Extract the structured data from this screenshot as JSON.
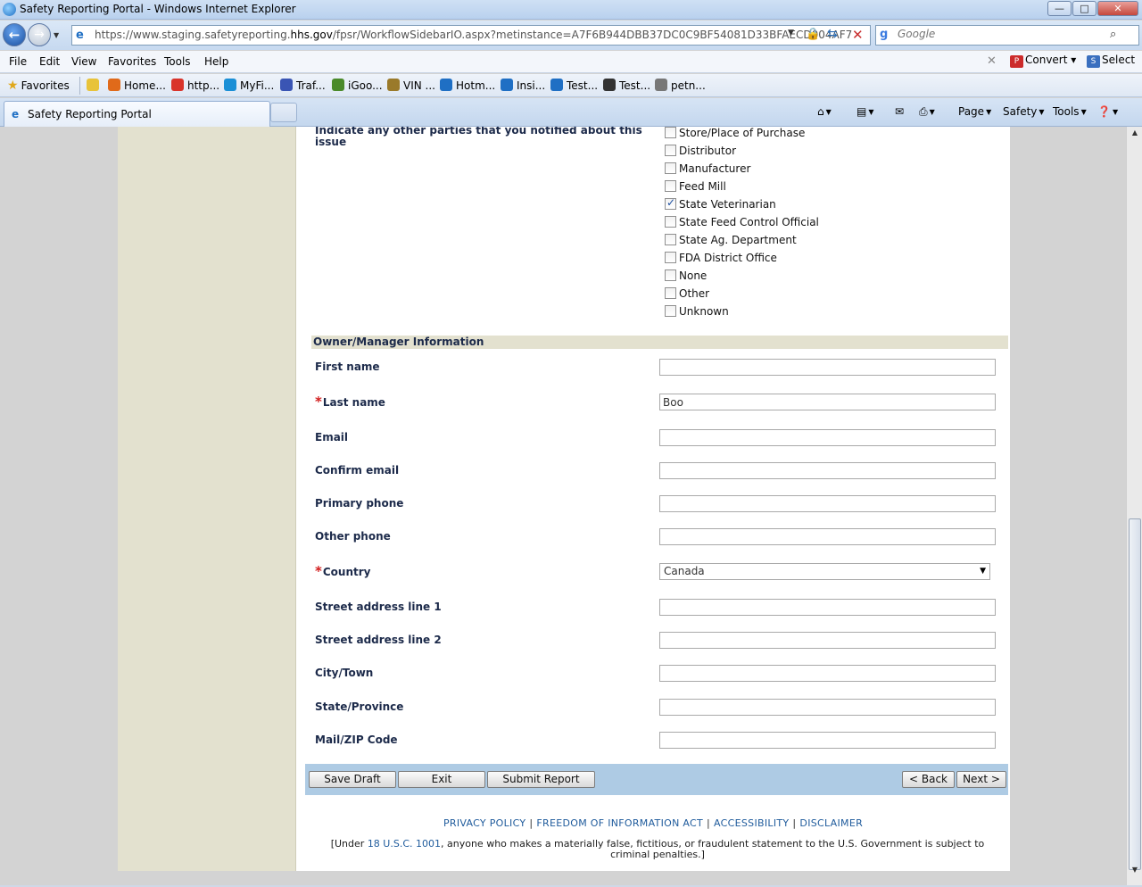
{
  "window": {
    "title": "Safety Reporting Portal - Windows Internet Explorer",
    "min": "—",
    "max": "□",
    "close": "✕"
  },
  "address": {
    "url_prefix": "https://www.staging.safetyreporting.",
    "url_host": "hhs.gov",
    "url_suffix": "/fpsr/WorkflowSidebarIO.aspx?metinstance=A7F6B944DBB37DC0C9BF54081D33BFAECD004AF7"
  },
  "search": {
    "placeholder": "Google"
  },
  "menu": {
    "items": [
      "File",
      "Edit",
      "View",
      "Favorites",
      "Tools",
      "Help"
    ],
    "convert": "Convert",
    "select": "Select"
  },
  "favorites": {
    "label": "Favorites",
    "links": [
      {
        "label": "Home...",
        "color": "#e06a1a"
      },
      {
        "label": "http...",
        "color": "#d9342b"
      },
      {
        "label": "MyFi...",
        "color": "#1a8fd6"
      },
      {
        "label": "Traf...",
        "color": "#3a55b4"
      },
      {
        "label": "iGoo...",
        "color": "#4a8a2a"
      },
      {
        "label": "VIN ...",
        "color": "#9a7a2a"
      },
      {
        "label": "Hotm...",
        "color": "#1f6fc4"
      },
      {
        "label": "Insi...",
        "color": "#1f6fc4"
      },
      {
        "label": "Test...",
        "color": "#1f6fc4"
      },
      {
        "label": "Test...",
        "color": "#333333"
      },
      {
        "label": "petn...",
        "color": "#555555"
      }
    ]
  },
  "tab": {
    "label": "Safety Reporting Portal"
  },
  "commands": {
    "page": "Page",
    "safety": "Safety",
    "tools": "Tools"
  },
  "form": {
    "notify_question": "Indicate any other parties that you notified about this issue",
    "parties": [
      {
        "label": "Store/Place of Purchase",
        "checked": false
      },
      {
        "label": "Distributor",
        "checked": false
      },
      {
        "label": "Manufacturer",
        "checked": false
      },
      {
        "label": "Feed Mill",
        "checked": false
      },
      {
        "label": "State Veterinarian",
        "checked": true
      },
      {
        "label": "State Feed Control Official",
        "checked": false
      },
      {
        "label": "State Ag. Department",
        "checked": false
      },
      {
        "label": "FDA District Office",
        "checked": false
      },
      {
        "label": "None",
        "checked": false
      },
      {
        "label": "Other",
        "checked": false
      },
      {
        "label": "Unknown",
        "checked": false
      }
    ],
    "section_title": "Owner/Manager Information",
    "required_marker": "*",
    "fields": {
      "first_name": {
        "label": "First name",
        "value": ""
      },
      "last_name": {
        "label": "Last name",
        "value": "Boo"
      },
      "email": {
        "label": "Email",
        "value": ""
      },
      "confirm_email": {
        "label": "Confirm email",
        "value": ""
      },
      "primary_phone": {
        "label": "Primary phone",
        "value": ""
      },
      "other_phone": {
        "label": "Other phone",
        "value": ""
      },
      "country": {
        "label": "Country",
        "value": "Canada"
      },
      "street1": {
        "label": "Street address line 1",
        "value": ""
      },
      "street2": {
        "label": "Street address line 2",
        "value": ""
      },
      "city": {
        "label": "City/Town",
        "value": ""
      },
      "state": {
        "label": "State/Province",
        "value": ""
      },
      "zip": {
        "label": "Mail/ZIP Code",
        "value": ""
      }
    }
  },
  "buttons": {
    "save_draft": "Save Draft",
    "exit": "Exit",
    "submit": "Submit Report",
    "back": "< Back",
    "next": "Next >"
  },
  "footer": {
    "links": [
      "PRIVACY POLICY",
      "FREEDOM OF INFORMATION ACT",
      "ACCESSIBILITY",
      "DISCLAIMER"
    ],
    "legal_prefix": "[Under ",
    "legal_link": "18 U.S.C. 1001",
    "legal_suffix": ", anyone who makes a materially false, fictitious, or fraudulent statement to the U.S. Government is subject to criminal penalties.]"
  }
}
